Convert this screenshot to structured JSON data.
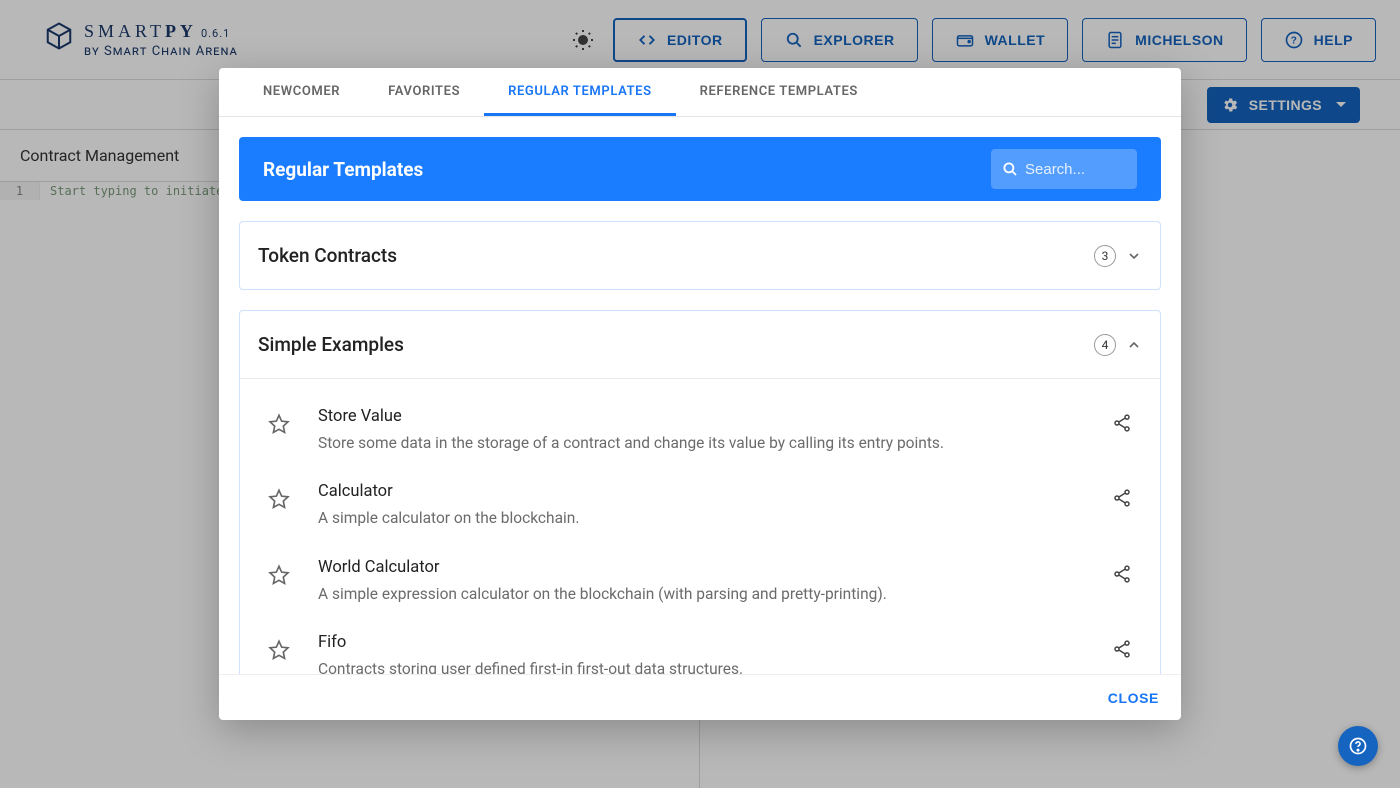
{
  "logo": {
    "smart": "SMART",
    "py": "PY",
    "version": "0.6.1",
    "byline": "by Smart Chain Arena"
  },
  "nav": {
    "editor": "EDITOR",
    "explorer": "EXPLORER",
    "wallet": "WALLET",
    "michelson": "MICHELSON",
    "help": "HELP"
  },
  "settings_label": "SETTINGS",
  "left_pane": {
    "title": "Contract Management",
    "line_no": "1",
    "placeholder": "Start typing to initiate a contract."
  },
  "modal": {
    "tabs": {
      "newcomer": "NEWCOMER",
      "favorites": "FAVORITES",
      "regular": "REGULAR TEMPLATES",
      "reference": "REFERENCE TEMPLATES"
    },
    "section_title": "Regular Templates",
    "search_placeholder": "Search...",
    "groups": [
      {
        "title": "Token Contracts",
        "count": "3",
        "expanded": false
      },
      {
        "title": "Simple Examples",
        "count": "4",
        "expanded": true
      }
    ],
    "templates": [
      {
        "title": "Store Value",
        "desc": "Store some data in the storage of a contract and change its value by calling its entry points."
      },
      {
        "title": "Calculator",
        "desc": "A simple calculator on the blockchain."
      },
      {
        "title": "World Calculator",
        "desc": "A simple expression calculator on the blockchain (with parsing and pretty-printing)."
      },
      {
        "title": "Fifo",
        "desc": "Contracts storing user defined first-in first-out data structures."
      }
    ],
    "close": "CLOSE"
  }
}
